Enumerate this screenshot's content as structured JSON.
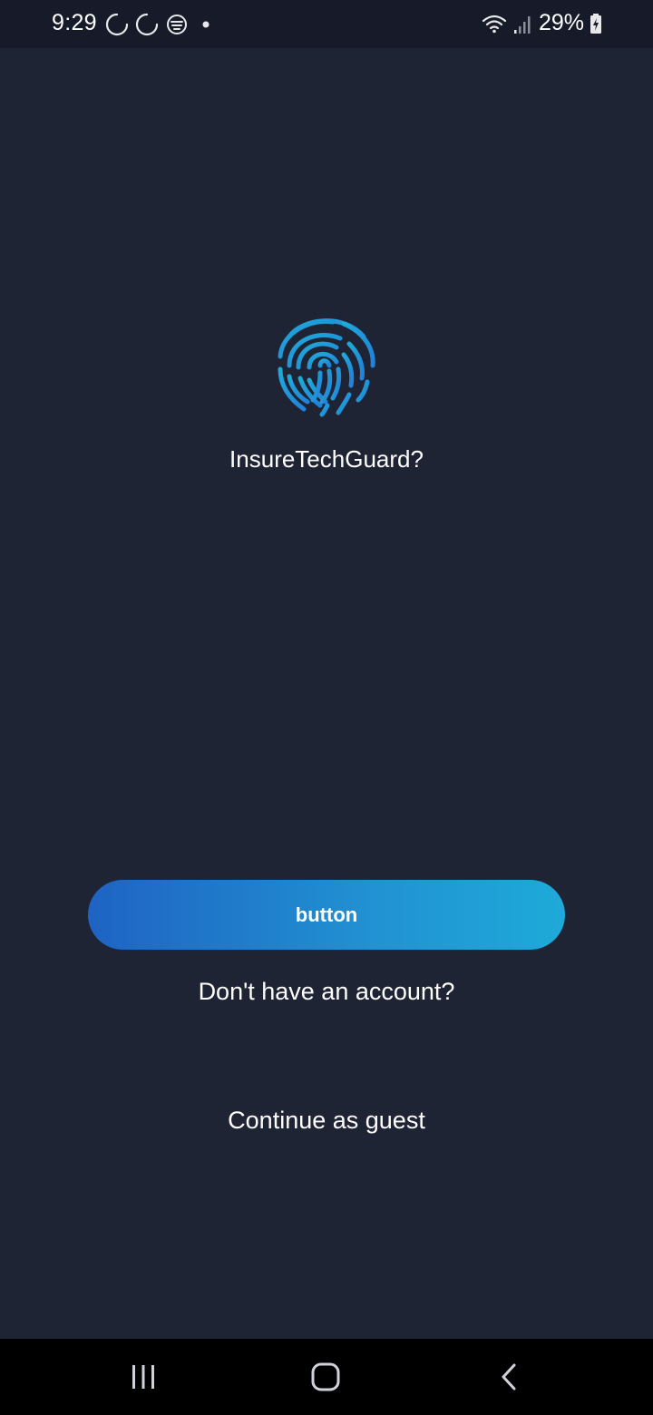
{
  "status_bar": {
    "time": "9:29",
    "battery": "29%",
    "icons_left": [
      "sync-icon",
      "sync-icon",
      "app-notification-icon",
      "dot-icon"
    ],
    "icons_right": [
      "wifi-icon",
      "signal-icon",
      "battery-charging-icon"
    ]
  },
  "main": {
    "logo_icon": "fingerprint-icon",
    "title": "InsureTechGuard?",
    "primary_button_label": "button",
    "signup_prompt": "Don't have an account?",
    "guest_label": "Continue as guest"
  },
  "nav_bar": {
    "buttons": [
      "recent-apps-icon",
      "home-icon",
      "back-icon"
    ]
  },
  "colors": {
    "background": "#1f2435",
    "status_bar": "#171b29",
    "accent_start": "#1f63c3",
    "accent_end": "#1eaad9"
  }
}
